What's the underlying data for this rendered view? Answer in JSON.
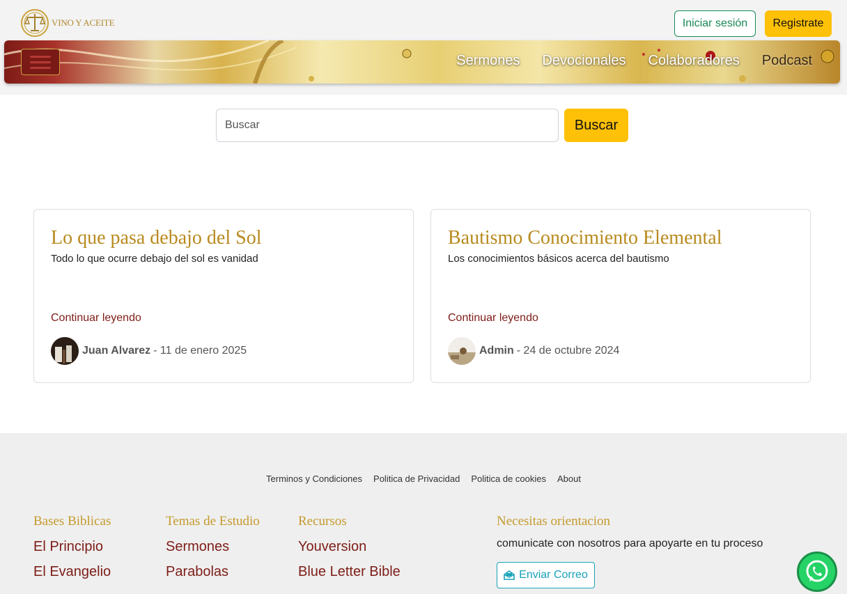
{
  "header": {
    "logo_text": "VINO Y ACEITE",
    "login_label": "Iniciar sesión",
    "register_label": "Registrate"
  },
  "nav": {
    "links": [
      "Sermones",
      "Devocionales",
      "Colaboradores",
      "Podcast"
    ]
  },
  "search": {
    "placeholder": "Buscar",
    "button_label": "Buscar"
  },
  "posts": [
    {
      "title": "Lo que pasa debajo del Sol",
      "description": "Todo lo que ocurre debajo del sol es vanidad",
      "read_more": "Continuar leyendo",
      "author": "Juan Alvarez",
      "date": "- 11 de enero 2025"
    },
    {
      "title": "Bautismo Conocimiento Elemental",
      "description": "Los conocimientos básicos acerca del bautismo",
      "read_more": "Continuar leyendo",
      "author": "Admin",
      "date": "- 24 de octubre 2024"
    }
  ],
  "footer": {
    "links": [
      "Terminos y Condiciones",
      "Politica de Privacidad",
      "Politica de cookies",
      "About"
    ],
    "columns": [
      {
        "title": "Bases Biblicas",
        "items": [
          "El Principio",
          "El Evangelio"
        ]
      },
      {
        "title": "Temas de Estudio",
        "items": [
          "Sermones",
          "Parabolas"
        ]
      },
      {
        "title": "Recursos",
        "items": [
          "Youversion",
          "Blue Letter Bible"
        ]
      }
    ],
    "orientation": {
      "title": "Necesitas orientacion",
      "text": "comunicate con nosotros para apoyarte en tu proceso",
      "button_label": "Enviar Correo"
    }
  },
  "colors": {
    "gold": "#b88a1e",
    "wine": "#7d1d17",
    "yellow_button": "#ffc107",
    "green_outline": "#198754",
    "teal_outline": "#17a2b8",
    "whatsapp": "#25d366"
  },
  "icons": {
    "logo": "scales-emblem-icon",
    "menu": "hamburger-menu-icon",
    "mail": "envelope-open-icon",
    "chat": "whatsapp-icon"
  }
}
